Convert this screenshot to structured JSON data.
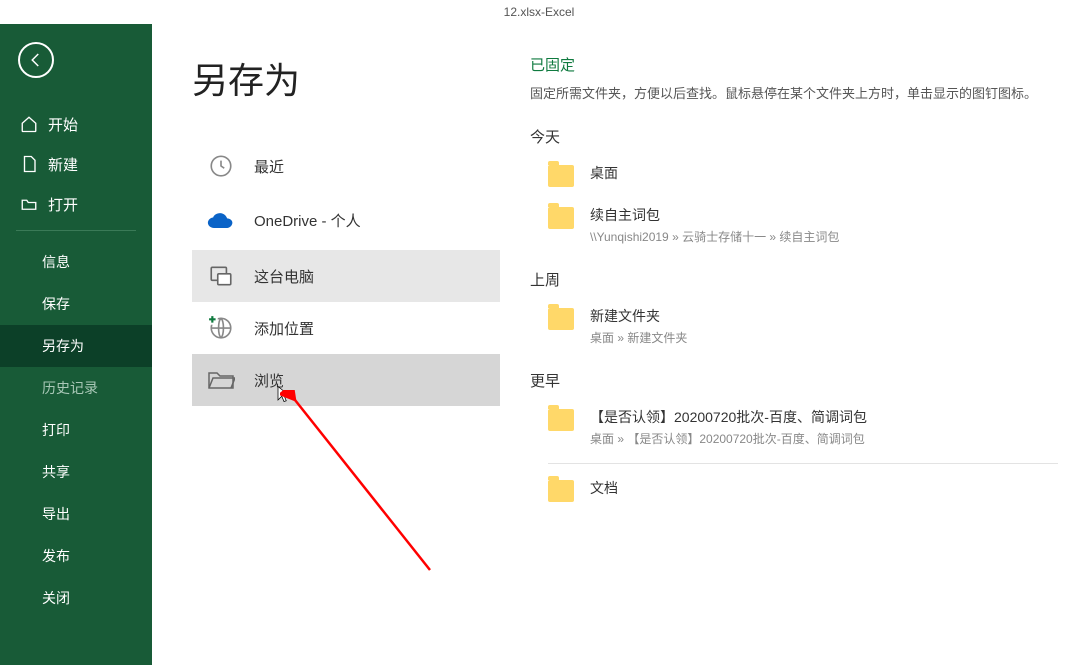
{
  "titlebar": {
    "filename": "12.xlsx",
    "sep": " - ",
    "app": "Excel"
  },
  "sidebar": {
    "home": "开始",
    "new": "新建",
    "open": "打开",
    "info": "信息",
    "save": "保存",
    "saveas": "另存为",
    "history": "历史记录",
    "print": "打印",
    "share": "共享",
    "export": "导出",
    "publish": "发布",
    "close": "关闭"
  },
  "page": {
    "title": "另存为"
  },
  "locations": {
    "recent": "最近",
    "onedrive": "OneDrive - 个人",
    "onedrive_sub": "",
    "thispc": "这台电脑",
    "addplace": "添加位置",
    "browse": "浏览"
  },
  "right": {
    "pinned_head": "已固定",
    "pinned_desc": "固定所需文件夹，方便以后查找。鼠标悬停在某个文件夹上方时，单击显示的图钉图标。",
    "today": "今天",
    "lastweek": "上周",
    "older": "更早",
    "folders": {
      "desktop": {
        "name": "桌面"
      },
      "xuzi": {
        "name": "续自主词包",
        "path": "\\\\Yunqishi2019 » 云骑士存储十一 » 续自主词包"
      },
      "newfolder": {
        "name": "新建文件夹",
        "path": "桌面 » 新建文件夹"
      },
      "batch": {
        "name": "【是否认领】20200720批次-百度、简调词包",
        "path": "桌面 » 【是否认领】20200720批次-百度、简调词包"
      },
      "docs": {
        "name": "文档"
      }
    }
  }
}
